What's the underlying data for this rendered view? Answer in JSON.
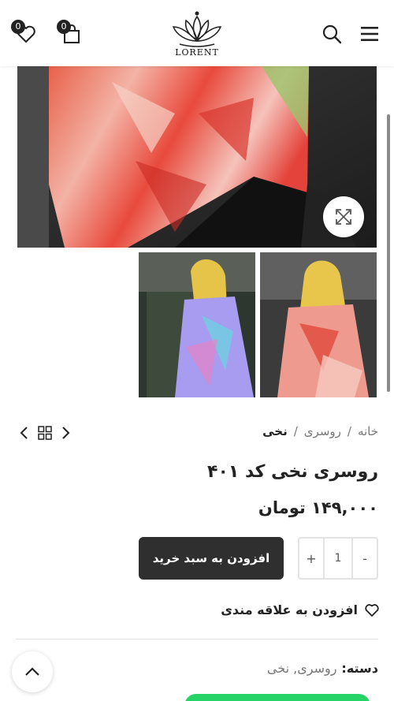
{
  "header": {
    "wishlist_count": "0",
    "cart_count": "0",
    "logo_text": "LORENT",
    "icons": [
      "heart-icon",
      "bag-icon",
      "search-icon",
      "menu-icon"
    ]
  },
  "gallery": {
    "expand_icon": "expand-icon",
    "thumbnail_count": 2
  },
  "breadcrumb": {
    "home": "خانه",
    "sep1": "/",
    "category": "روسری",
    "sep2": "/",
    "current": "نخی"
  },
  "product": {
    "title": "روسری نخی کد ۴۰۱",
    "price": "۱۴۹,۰۰۰ تومان"
  },
  "cart": {
    "qty_plus": "+",
    "qty_value": "1",
    "qty_minus": "-",
    "add_to_cart": "افزودن به سبد خرید"
  },
  "wishlist": {
    "label": "افزودن به علاقه مندی"
  },
  "meta": {
    "category_label": "دسته:",
    "category_value": "روسری, نخی"
  },
  "colors": {
    "button_dark": "#2f2f2f",
    "whatsapp_green": "#25d366"
  }
}
